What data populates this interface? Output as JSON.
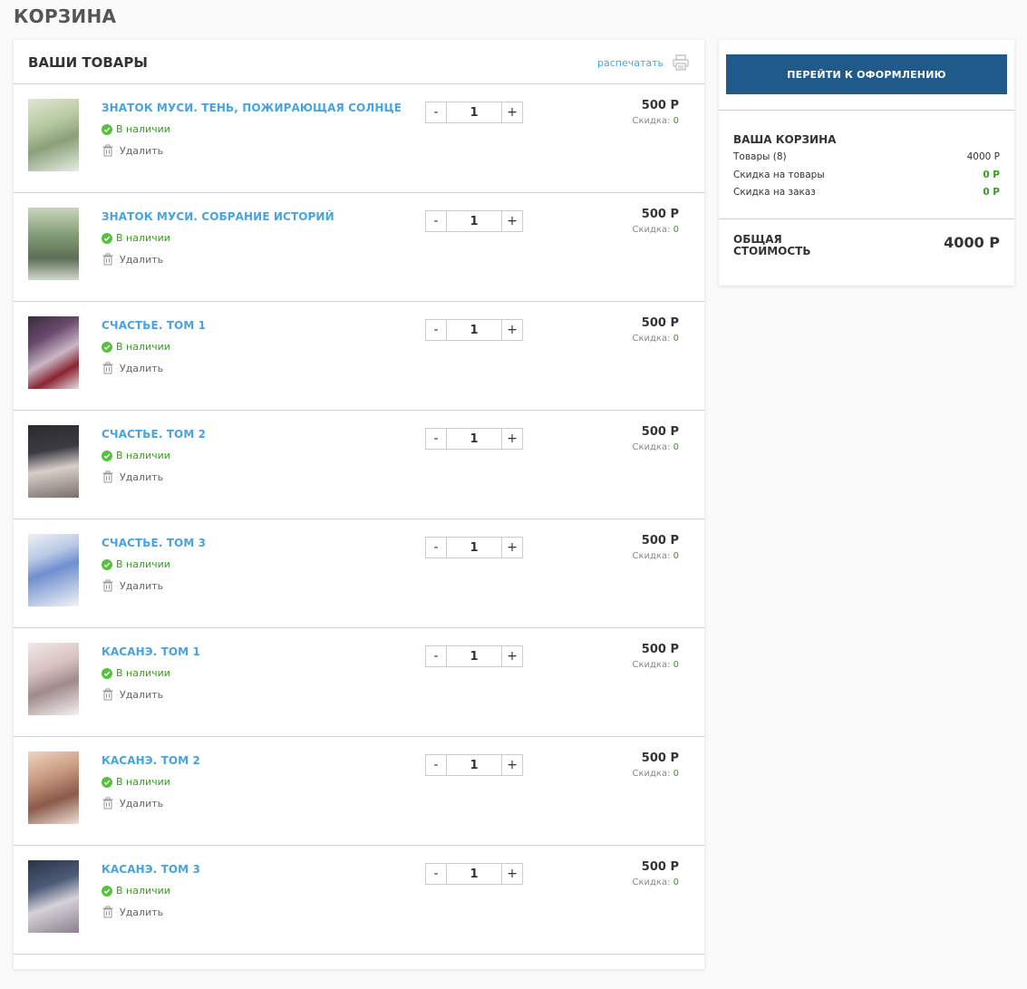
{
  "page_title": "КОРЗИНА",
  "items_panel": {
    "title": "ВАШИ ТОВАРЫ",
    "print_label": "распечатать"
  },
  "item_labels": {
    "stock": "В наличии",
    "delete": "Удалить",
    "discount_label": "Скидка: ",
    "minus": "-",
    "plus": "+"
  },
  "items": [
    {
      "name": "ЗНАТОК МУСИ. ТЕНЬ, ПОЖИРАЮЩАЯ СОЛНЦЕ",
      "qty": "1",
      "price": "500 Р",
      "discount": "0"
    },
    {
      "name": "ЗНАТОК МУСИ. СОБРАНИЕ ИСТОРИЙ",
      "qty": "1",
      "price": "500 Р",
      "discount": "0"
    },
    {
      "name": "СЧАСТЬЕ. ТОМ 1",
      "qty": "1",
      "price": "500 Р",
      "discount": "0"
    },
    {
      "name": "СЧАСТЬЕ. ТОМ 2",
      "qty": "1",
      "price": "500 Р",
      "discount": "0"
    },
    {
      "name": "СЧАСТЬЕ. ТОМ 3",
      "qty": "1",
      "price": "500 Р",
      "discount": "0"
    },
    {
      "name": "КАСАНЭ. ТОМ 1",
      "qty": "1",
      "price": "500 Р",
      "discount": "0"
    },
    {
      "name": "КАСАНЭ. ТОМ 2",
      "qty": "1",
      "price": "500 Р",
      "discount": "0"
    },
    {
      "name": "КАСАНЭ. ТОМ 3",
      "qty": "1",
      "price": "500 Р",
      "discount": "0"
    }
  ],
  "summary": {
    "checkout_label": "ПЕРЕЙТИ К ОФОРМЛЕНИЮ",
    "cart_title": "ВАША КОРЗИНА",
    "goods_label": "Товары (8)",
    "goods_value": "4000 Р",
    "item_discount_label": "Скидка на товары",
    "item_discount_value": "0 Р",
    "order_discount_label": "Скидка на заказ",
    "order_discount_value": "0 Р",
    "total_label": "ОБЩАЯ СТОИМОСТЬ",
    "total_value": "4000 Р"
  },
  "colors": {
    "link": "#4aa3df",
    "accent_button": "#1f5a8b",
    "in_stock": "#3a9d23"
  }
}
